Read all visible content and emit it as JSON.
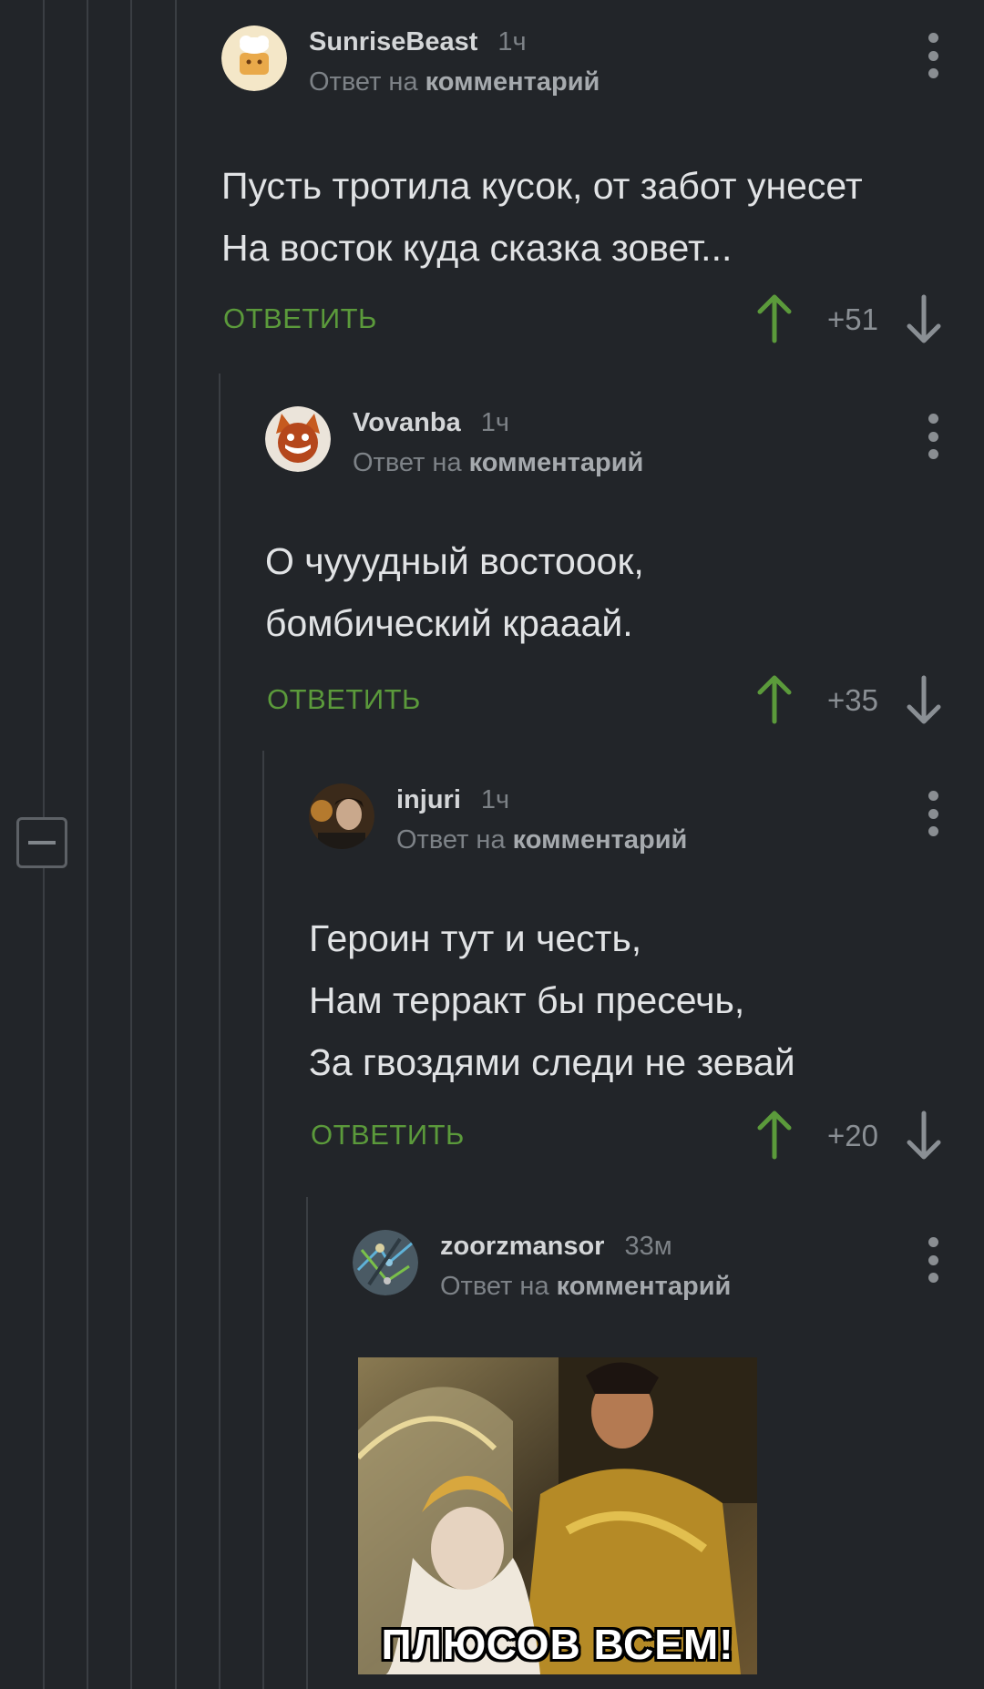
{
  "colors": {
    "background": "#222529",
    "accent_green": "#5b9a3b",
    "thread_line": "#3a3e43"
  },
  "thread": {
    "collapse_icon": "minus-icon"
  },
  "reply_prefix": "Ответ на",
  "reply_target": "комментарий",
  "reply_button": "ОТВЕТИТЬ",
  "comments": [
    {
      "username": "SunriseBeast",
      "time": "1ч",
      "lines": [
        "Пусть тротила кусок, от забот унесет",
        "На восток куда сказка зовет..."
      ],
      "score": "+51"
    },
    {
      "username": "Vovanba",
      "time": "1ч",
      "lines": [
        "О чууудный востооок,",
        "бомбический крааай."
      ],
      "score": "+35"
    },
    {
      "username": "injuri",
      "time": "1ч",
      "lines": [
        "Героин тут и честь,",
        "Нам терракт бы пресечь,",
        "За гвоздями следи не зевай"
      ],
      "score": "+20"
    },
    {
      "username": "zoorzmansor",
      "time": "33м",
      "image_caption": "ПЛЮСОВ ВСЕМ!"
    }
  ]
}
